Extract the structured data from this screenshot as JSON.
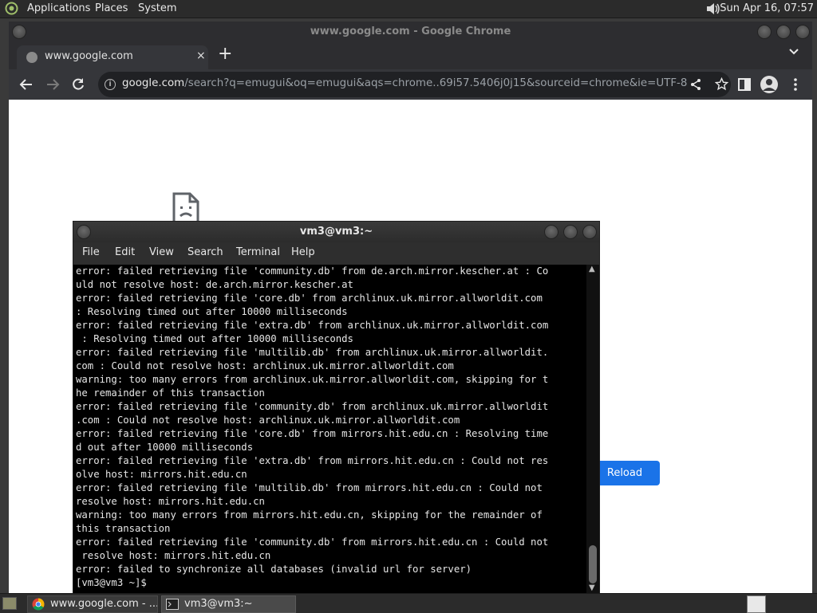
{
  "top_panel": {
    "menus": [
      "Applications",
      "Places",
      "System"
    ],
    "clock": "Sun Apr 16, 07:57"
  },
  "chrome": {
    "window_title": "www.google.com - Google Chrome",
    "tab_title": "www.google.com",
    "tab_close": "×",
    "new_tab": "+",
    "url_host": "google.com",
    "url_path": "/search?q=emugui&oq=emugui&aqs=chrome..69i57.5406j0j15&sourceid=chrome&ie=UTF-8",
    "reload_label": "Reload"
  },
  "terminal": {
    "window_title": "vm3@vm3:~",
    "menus": [
      "File",
      "Edit",
      "View",
      "Search",
      "Terminal",
      "Help"
    ],
    "lines": [
      "error: failed retrieving file 'community.db' from de.arch.mirror.kescher.at : Co",
      "uld not resolve host: de.arch.mirror.kescher.at",
      "error: failed retrieving file 'core.db' from archlinux.uk.mirror.allworldit.com",
      ": Resolving timed out after 10000 milliseconds",
      "error: failed retrieving file 'extra.db' from archlinux.uk.mirror.allworldit.com",
      " : Resolving timed out after 10000 milliseconds",
      "error: failed retrieving file 'multilib.db' from archlinux.uk.mirror.allworldit.",
      "com : Could not resolve host: archlinux.uk.mirror.allworldit.com",
      "warning: too many errors from archlinux.uk.mirror.allworldit.com, skipping for t",
      "he remainder of this transaction",
      "error: failed retrieving file 'community.db' from archlinux.uk.mirror.allworldit",
      ".com : Could not resolve host: archlinux.uk.mirror.allworldit.com",
      "error: failed retrieving file 'core.db' from mirrors.hit.edu.cn : Resolving time",
      "d out after 10000 milliseconds",
      "error: failed retrieving file 'extra.db' from mirrors.hit.edu.cn : Could not res",
      "olve host: mirrors.hit.edu.cn",
      "error: failed retrieving file 'multilib.db' from mirrors.hit.edu.cn : Could not",
      "resolve host: mirrors.hit.edu.cn",
      "warning: too many errors from mirrors.hit.edu.cn, skipping for the remainder of",
      "this transaction",
      "error: failed retrieving file 'community.db' from mirrors.hit.edu.cn : Could not",
      " resolve host: mirrors.hit.edu.cn",
      "error: failed to synchronize all databases (invalid url for server)",
      "[vm3@vm3 ~]$ "
    ]
  },
  "taskbar": {
    "tasks": [
      "www.google.com - ...",
      "vm3@vm3:~"
    ]
  },
  "colors": {
    "chrome_frame": "#2d2d30",
    "chrome_toolbar": "#35363a",
    "reload_blue": "#1a73e8",
    "terminal_bg": "#000000"
  }
}
